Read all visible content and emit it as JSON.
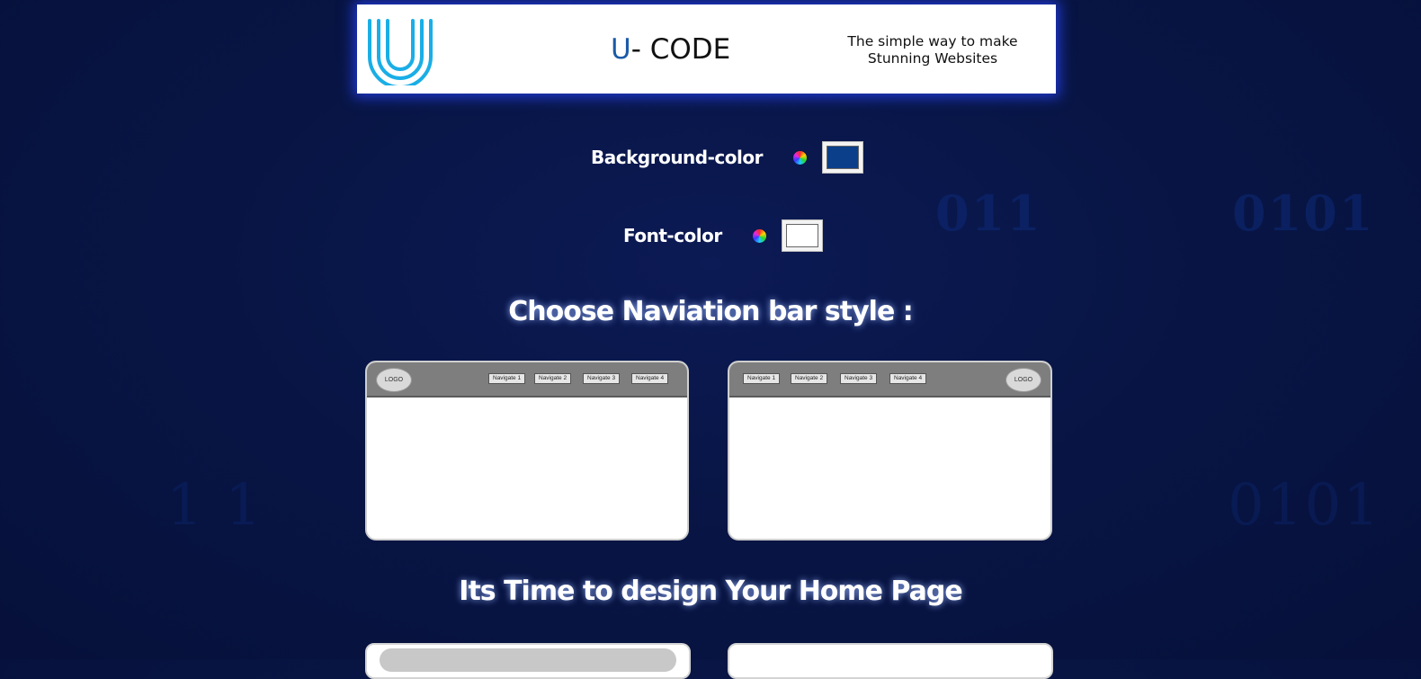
{
  "header": {
    "brand_initial": "U",
    "brand_rest": "- CODE",
    "tagline_line1": "The simple way to make",
    "tagline_line2": "Stunning Websites",
    "logo_icon": "u-logo-icon"
  },
  "colors": {
    "accent": "#1b5aa8",
    "background_color_value": "#0b3f8a",
    "font_color_value": "#ffffff"
  },
  "background_color": {
    "label": "Background-color"
  },
  "font_color": {
    "label": "Font-color"
  },
  "nav_section": {
    "title": "Choose Naviation bar style :",
    "styles": [
      {
        "logo": "LOGO",
        "items": [
          "Navigate 1",
          "Navigate 2",
          "Navigate 3",
          "Navigate 4"
        ]
      },
      {
        "logo": "LOGO",
        "items": [
          "Navigate 1",
          "Navigate 2",
          "Navigate 3",
          "Navigate 4"
        ]
      }
    ]
  },
  "home_section": {
    "title": "Its Time to design Your Home Page"
  },
  "background_digits": [
    "011",
    "0101",
    "1 1",
    "0101"
  ]
}
